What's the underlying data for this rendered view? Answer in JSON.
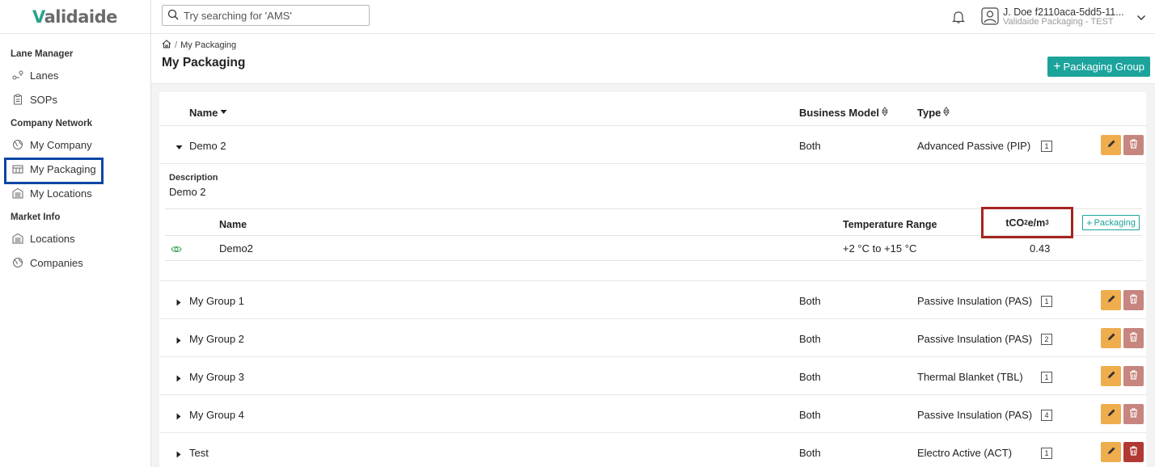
{
  "app": {
    "logo": "Validaide",
    "logo_v": "V",
    "logo_rest": "alidaide"
  },
  "sidebar": {
    "sections": [
      {
        "title": "Lane Manager",
        "items": [
          {
            "label": "Lanes",
            "icon": "lanes-icon"
          },
          {
            "label": "SOPs",
            "icon": "clipboard-icon"
          }
        ]
      },
      {
        "title": "Company Network",
        "items": [
          {
            "label": "My Company",
            "icon": "globe-icon"
          },
          {
            "label": "My Packaging",
            "icon": "packaging-icon",
            "active": true
          },
          {
            "label": "My Locations",
            "icon": "warehouse-icon"
          }
        ]
      },
      {
        "title": "Market Info",
        "items": [
          {
            "label": "Locations",
            "icon": "warehouse-icon"
          },
          {
            "label": "Companies",
            "icon": "globe-icon"
          }
        ]
      }
    ]
  },
  "header": {
    "search_placeholder": "Try searching for 'AMS'",
    "user_name": "J. Doe f2110aca-5dd5-11...",
    "user_company": "Validaide Packaging - TEST"
  },
  "page": {
    "breadcrumb": "My Packaging",
    "title": "My Packaging",
    "add_group_label": "Packaging Group"
  },
  "table": {
    "columns": {
      "name": "Name",
      "business_model": "Business Model",
      "type": "Type"
    },
    "rows": [
      {
        "name": "Demo 2",
        "business_model": "Both",
        "type": "Advanced Passive (PIP)",
        "count": "1",
        "expanded": true
      },
      {
        "name": "My Group 1",
        "business_model": "Both",
        "type": "Passive Insulation (PAS)",
        "count": "1"
      },
      {
        "name": "My Group 2",
        "business_model": "Both",
        "type": "Passive Insulation (PAS)",
        "count": "2"
      },
      {
        "name": "My Group 3",
        "business_model": "Both",
        "type": "Thermal Blanket (TBL)",
        "count": "1"
      },
      {
        "name": "My Group 4",
        "business_model": "Both",
        "type": "Passive Insulation (PAS)",
        "count": "4"
      },
      {
        "name": "Test",
        "business_model": "Both",
        "type": "Electro Active (ACT)",
        "count": "1"
      }
    ]
  },
  "detail": {
    "description_label": "Description",
    "description_value": "Demo 2",
    "columns": {
      "name": "Name",
      "temperature": "Temperature Range",
      "co2_prefix": "tCO",
      "co2_sub": "2",
      "co2_mid": "e/m",
      "co2_sup": "3"
    },
    "add_packaging_label": "Packaging",
    "packaging": [
      {
        "name": "Demo2",
        "temperature": "+2 °C to +15 °C",
        "co2": "0.43"
      }
    ]
  },
  "colors": {
    "accent": "#1ba39c",
    "edit": "#f0ad4e",
    "delete": "#c7857f",
    "highlight_red": "#a52421",
    "highlight_blue": "#0b46a5"
  }
}
